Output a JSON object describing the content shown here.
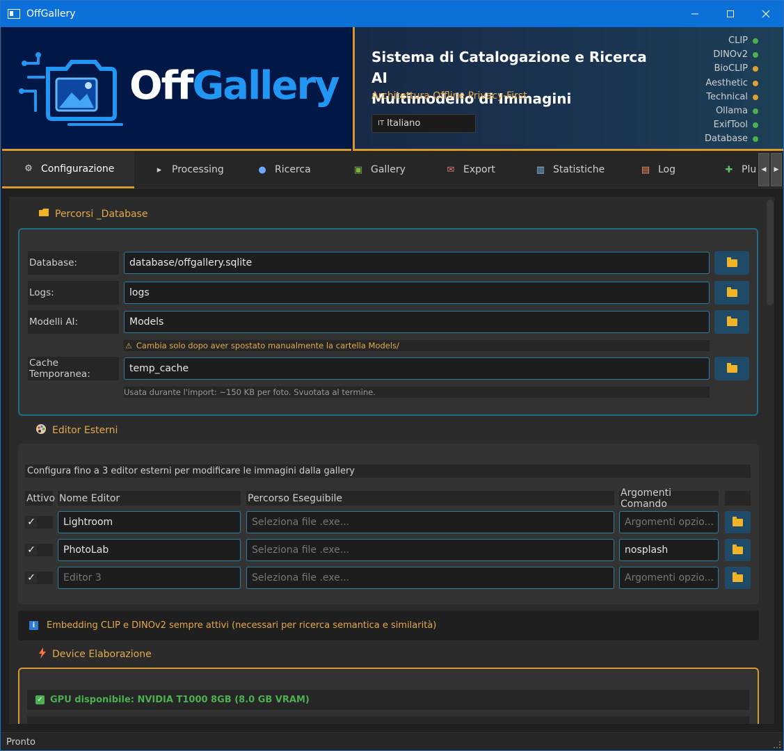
{
  "window": {
    "title": "OffGallery"
  },
  "banner": {
    "logo_off": "Off",
    "logo_gallery": "Gallery",
    "title_line1": "Sistema di Catalogazione e Ricerca AI",
    "title_line2": "Multimodello di Immagini",
    "subtitle": "Architettura Offline Privacy-First",
    "language_flag": "IT",
    "language": "Italiano",
    "status": [
      {
        "label": "CLIP",
        "color": "#4caf50"
      },
      {
        "label": "DINOv2",
        "color": "#4caf50"
      },
      {
        "label": "BioCLIP",
        "color": "#e0a030"
      },
      {
        "label": "Aesthetic",
        "color": "#e0a030"
      },
      {
        "label": "Technical",
        "color": "#e0a030"
      },
      {
        "label": "Ollama",
        "color": "#4caf50"
      },
      {
        "label": "ExifTool",
        "color": "#4caf50"
      },
      {
        "label": "Database",
        "color": "#4caf50"
      }
    ]
  },
  "tabs": [
    {
      "label": "Configurazione",
      "icon": "gear-icon"
    },
    {
      "label": "Processing",
      "icon": "play-icon"
    },
    {
      "label": "Ricerca",
      "icon": "magnifier-icon"
    },
    {
      "label": "Gallery",
      "icon": "picture-icon"
    },
    {
      "label": "Export",
      "icon": "export-icon"
    },
    {
      "label": "Statistiche",
      "icon": "bar-chart-icon"
    },
    {
      "label": "Log",
      "icon": "document-icon"
    },
    {
      "label": "Plu",
      "icon": "puzzle-icon"
    }
  ],
  "paths": {
    "title": "Percorsi _Database",
    "rows": [
      {
        "label": "Database:",
        "value": "database/offgallery.sqlite"
      },
      {
        "label": "Logs:",
        "value": "logs"
      },
      {
        "label": "Modelli AI:",
        "value": "Models"
      },
      {
        "label": "Cache Temporanea:",
        "value": "temp_cache"
      }
    ],
    "models_warning": "Cambia solo dopo aver spostato manualmente la cartella Models/",
    "cache_hint": "Usata durante l'import: ~150 KB per foto. Svuotata al termine."
  },
  "editors": {
    "title": "Editor Esterni",
    "description": "Configura fino a 3 editor esterni per modificare le immagini dalla gallery",
    "headers": {
      "active": "Attivo",
      "name": "Nome Editor",
      "path": "Percorso Eseguibile",
      "args": "Argomenti Comando"
    },
    "rows": [
      {
        "checked": "✓",
        "name": "Lightroom",
        "name_is_placeholder": false,
        "path": "Seleziona file .exe...",
        "args": "Argomenti opzio...",
        "args_is_placeholder": true
      },
      {
        "checked": "✓",
        "name": "PhotoLab",
        "name_is_placeholder": false,
        "path": "Seleziona file .exe...",
        "args": "nosplash",
        "args_is_placeholder": false
      },
      {
        "checked": "✓",
        "name": "Editor 3",
        "name_is_placeholder": true,
        "path": "Seleziona file .exe...",
        "args": "Argomenti opzio...",
        "args_is_placeholder": true
      }
    ]
  },
  "embedding_info": "Embedding CLIP e DINOv2 sempre attivi (necessari per ricerca semantica e similarità)",
  "device": {
    "title": "Device Elaborazione",
    "gpu_status": "GPU disponibile: NVIDIA T1000 8GB (8.0 GB VRAM)"
  },
  "statusbar": {
    "text": "Pronto"
  }
}
